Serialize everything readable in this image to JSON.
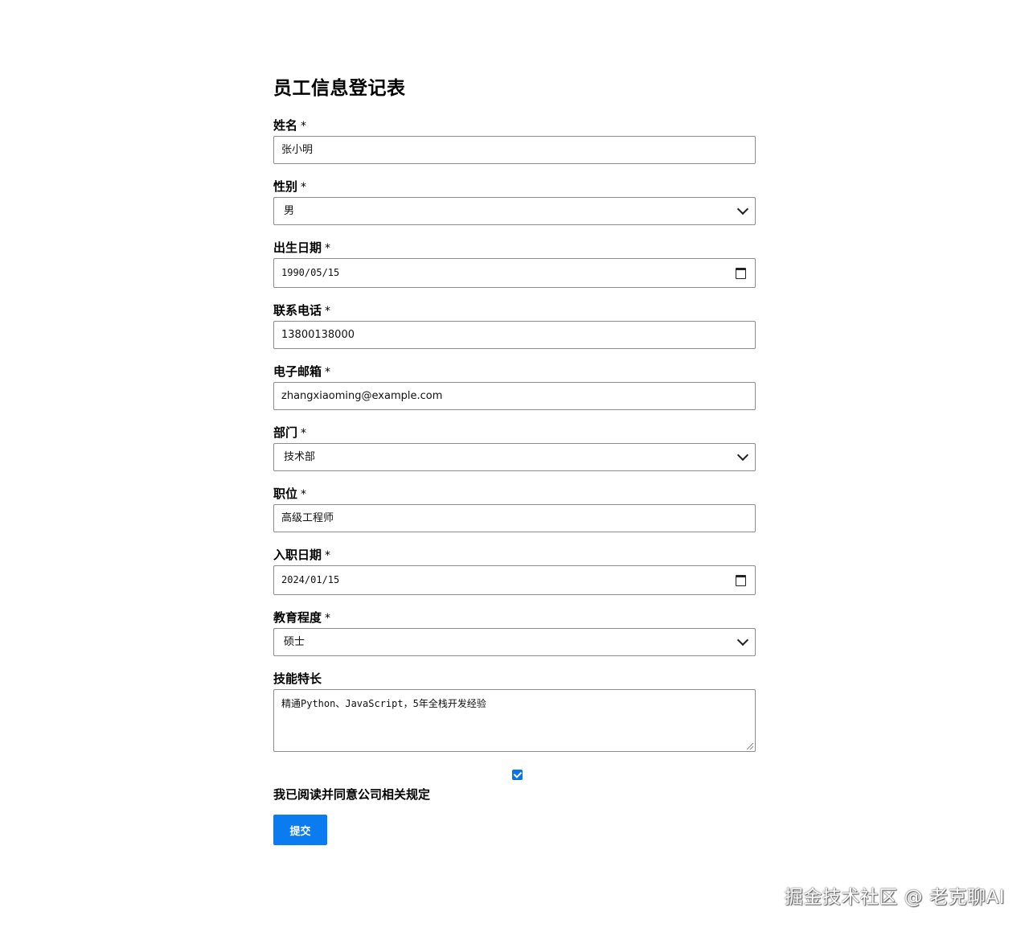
{
  "form": {
    "title": "员工信息登记表",
    "required_mark": "*",
    "fields": {
      "name": {
        "label": "姓名",
        "value": "张小明"
      },
      "gender": {
        "label": "性别",
        "value": "男"
      },
      "birth_date": {
        "label": "出生日期",
        "value": "1990/05/15"
      },
      "phone": {
        "label": "联系电话",
        "value": "13800138000"
      },
      "email": {
        "label": "电子邮箱",
        "value": "zhangxiaoming@example.com"
      },
      "department": {
        "label": "部门",
        "value": "技术部"
      },
      "position": {
        "label": "职位",
        "value": "高级工程师"
      },
      "hire_date": {
        "label": "入职日期",
        "value": "2024/01/15"
      },
      "education": {
        "label": "教育程度",
        "value": "硕士"
      },
      "skills": {
        "label": "技能特长",
        "value": "精通Python、JavaScript，5年全栈开发经验"
      }
    },
    "agreement": {
      "label": "我已阅读并同意公司相关规定",
      "checked": true
    },
    "submit_label": "提交"
  },
  "watermark": "掘金技术社区 @ 老克聊AI",
  "colors": {
    "accent": "#0b7cf0",
    "border": "#8c8c8c"
  },
  "icons": {
    "select": "chevron-down-icon",
    "date": "calendar-icon",
    "checkbox": "check-icon"
  }
}
